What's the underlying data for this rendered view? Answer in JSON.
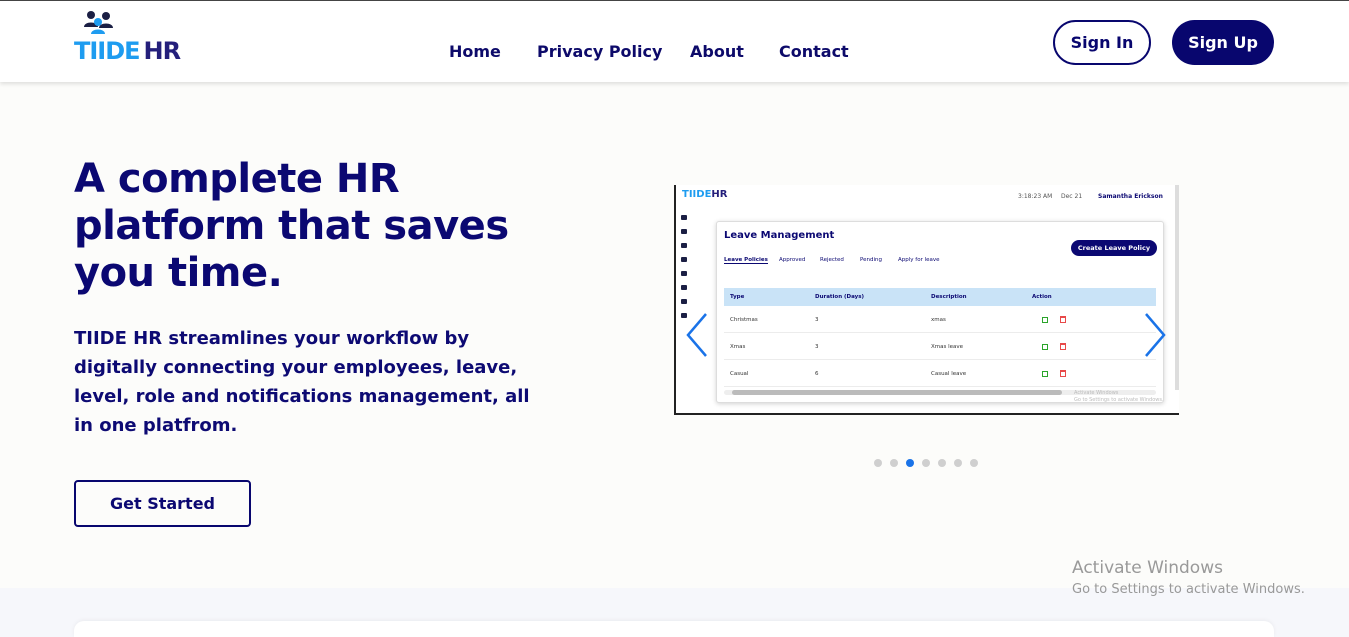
{
  "header": {
    "logo": {
      "text_a": "TIIDE",
      "text_b": "HR",
      "icon": "people-group-icon"
    },
    "nav": [
      "Home",
      "Privacy Policy",
      "About",
      "Contact"
    ],
    "signin_label": "Sign In",
    "signup_label": "Sign Up"
  },
  "hero": {
    "title": "A complete HR platform that saves you time.",
    "description": "TIIDE HR streamlines your workflow by digitally connecting your employees, leave, level, role and notifications management, all in one platfrom.",
    "cta_label": "Get Started"
  },
  "carousel": {
    "slide_count": 7,
    "active_index": 2,
    "prev_icon": "chevron-left-icon",
    "next_icon": "chevron-right-icon",
    "slide": {
      "logo_a": "TIIDE",
      "logo_b": "HR",
      "time": "3:18:23 AM",
      "date": "Dec 21",
      "user": "Samantha Erickson",
      "card_title": "Leave Management",
      "create_button": "Create Leave Policy",
      "tabs": [
        "Leave Policies",
        "Approved",
        "Rejected",
        "Pending",
        "Apply for leave"
      ],
      "columns": [
        "Type",
        "Duration (Days)",
        "Description",
        "Action"
      ],
      "rows": [
        [
          "Christmas",
          "3",
          "xmas"
        ],
        [
          "Xmas",
          "3",
          "Xmas leave"
        ],
        [
          "Casual",
          "6",
          "Casual leave"
        ]
      ],
      "watermark_line1": "Activate Windows",
      "watermark_line2": "Go to Settings to activate Windows."
    }
  },
  "overlay": {
    "activate_title": "Activate Windows",
    "activate_sub": "Go to Settings to activate Windows."
  },
  "colors": {
    "primary_navy": "#08066e",
    "logo_blue": "#1e9cf0",
    "active_dot": "#1a73e8",
    "arrow_blue": "#1a73e8"
  }
}
